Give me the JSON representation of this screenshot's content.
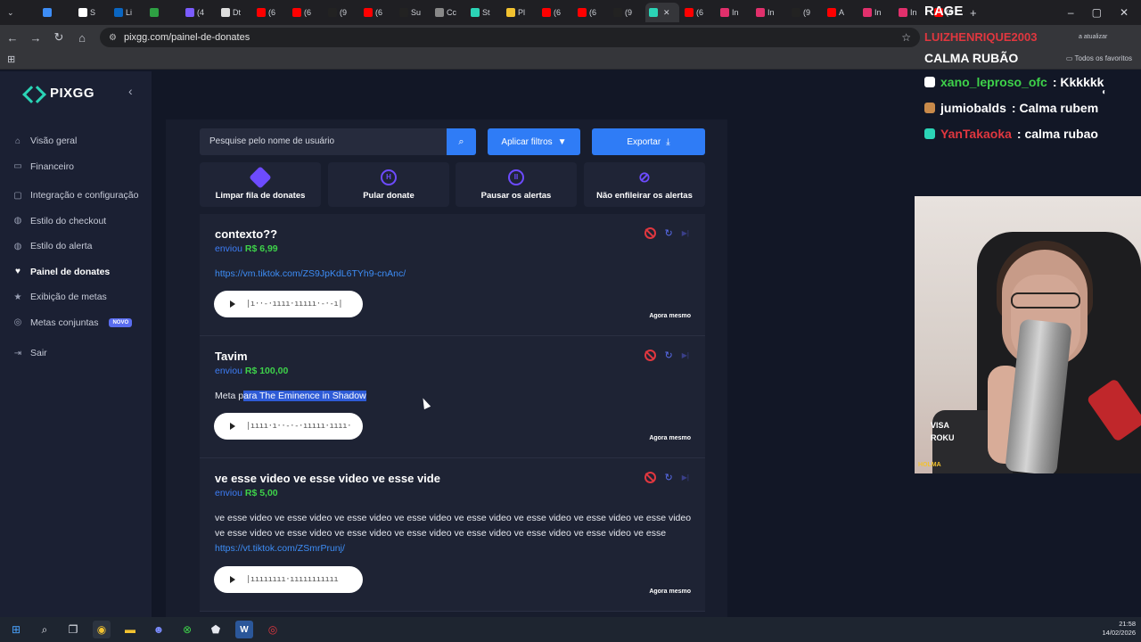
{
  "browser": {
    "tabs": [
      {
        "label": "",
        "color": "#3d8df6"
      },
      {
        "label": "S",
        "color": "#ffffff"
      },
      {
        "label": "Li",
        "color": "#0a66c2"
      },
      {
        "label": "",
        "color": "#2ea043"
      },
      {
        "label": "(4",
        "color": "#7b5cff"
      },
      {
        "label": "Dt",
        "color": "#dddddd"
      },
      {
        "label": "(6",
        "color": "#ff0000"
      },
      {
        "label": "(6",
        "color": "#ff0000"
      },
      {
        "label": "(9",
        "color": "#222222"
      },
      {
        "label": "(6",
        "color": "#ff0000"
      },
      {
        "label": "Su",
        "color": "#222222"
      },
      {
        "label": "Cc",
        "color": "#888888"
      },
      {
        "label": "St",
        "color": "#2bd4b6"
      },
      {
        "label": "Pl",
        "color": "#f2c230"
      },
      {
        "label": "(6",
        "color": "#ff0000"
      },
      {
        "label": "(6",
        "color": "#ff0000"
      },
      {
        "label": "(9",
        "color": "#222222"
      },
      {
        "label": "",
        "color": "#2bd4b6",
        "active": true
      },
      {
        "label": "(6",
        "color": "#ff0000"
      },
      {
        "label": "In",
        "color": "#e1306c"
      },
      {
        "label": "In",
        "color": "#e1306c"
      },
      {
        "label": "(9",
        "color": "#222222"
      },
      {
        "label": "A",
        "color": "#ff0000"
      },
      {
        "label": "In",
        "color": "#e1306c"
      },
      {
        "label": "In",
        "color": "#e1306c"
      },
      {
        "label": "(6",
        "color": "#ff0000"
      }
    ],
    "new_tab": "+",
    "url": "pixgg.com/painel-de-donates",
    "favorites_label": "Todos os favoritos",
    "update_label": "a atualizar"
  },
  "sidebar": {
    "logo": "PIXGG",
    "items": [
      {
        "label": "Visão geral",
        "icon": "home-icon",
        "glyph": "⌂"
      },
      {
        "label": "Financeiro",
        "icon": "wallet-icon",
        "glyph": "▭"
      },
      {
        "label": "Integração e configuração",
        "icon": "integration-icon",
        "glyph": "▢"
      },
      {
        "label": "Estilo do checkout",
        "icon": "palette-icon",
        "glyph": "◍"
      },
      {
        "label": "Estilo do alerta",
        "icon": "palette-icon",
        "glyph": "◍"
      },
      {
        "label": "Painel de donates",
        "icon": "donate-icon",
        "glyph": "♥",
        "active": true
      },
      {
        "label": "Exibição de metas",
        "icon": "star-icon",
        "glyph": "★"
      },
      {
        "label": "Metas conjuntas",
        "icon": "target-icon",
        "glyph": "◎",
        "badge": "NOVO"
      },
      {
        "label": "Sair",
        "icon": "logout-icon",
        "glyph": "⇥"
      }
    ]
  },
  "toolbar": {
    "search_placeholder": "Pesquise pelo nome de usuário",
    "filters_label": "Aplicar filtros",
    "export_label": "Exportar"
  },
  "actions": [
    {
      "label": "Limpar fila de donates",
      "icon": "eraser-icon"
    },
    {
      "label": "Pular donate",
      "icon": "skip-icon"
    },
    {
      "label": "Pausar os alertas",
      "icon": "pause-icon"
    },
    {
      "label": "Não enfileirar os alertas",
      "icon": "bell-off-icon"
    }
  ],
  "donations": [
    {
      "name": "contexto??",
      "sent_label": "enviou",
      "amount": "R$ 6,99",
      "message_pre": "",
      "message_link": "https://vm.tiktok.com/ZS9JpKdL6TYh9-cnAnc/",
      "message_hl": "",
      "when": "Agora mesmo"
    },
    {
      "name": "Tavim",
      "sent_label": "enviou",
      "amount": "R$ 100,00",
      "message_pre": "Meta p",
      "message_hl": "ara The Eminence in Shadow",
      "message_link": "",
      "when": "Agora mesmo"
    },
    {
      "name": "ve esse video ve esse video ve esse vide",
      "sent_label": "enviou",
      "amount": "R$ 5,00",
      "message_pre": "ve esse video ve esse video ve esse video ve esse video ve esse video ve esse video ve esse video ve esse video ve esse video ve esse video ve esse video ve esse video ve esse video ve esse video ve esse video ve esse",
      "message_link": "https://vt.tiktok.com/ZSmrPrunj/",
      "message_hl": "",
      "when": "Agora mesmo"
    }
  ],
  "stream_overlay": {
    "rage": "RAGE",
    "top_name": "LUIZHENRIQUE2003",
    "title": "CALMA RUBÃO",
    "chat": [
      {
        "user": "xano_leproso_ofc",
        "user_color": "#3ed24a",
        "text": ": Kkkkkk",
        "badge_color": "#ffffff"
      },
      {
        "user": "jumiobalds",
        "user_color": "#ffffff",
        "text": ": Calma rubem",
        "badge_color": "#c88a4a"
      },
      {
        "user": "YanTakaoka",
        "user_color": "#e0373f",
        "text": ": calma rubao",
        "badge_color": "#2bd4b6"
      }
    ],
    "cam_text_1": "VISA",
    "cam_text_2": "ROKU",
    "cam_text_3": "HOLMA"
  },
  "taskbar": {
    "time": "21:58",
    "date": "14/02/2026"
  }
}
